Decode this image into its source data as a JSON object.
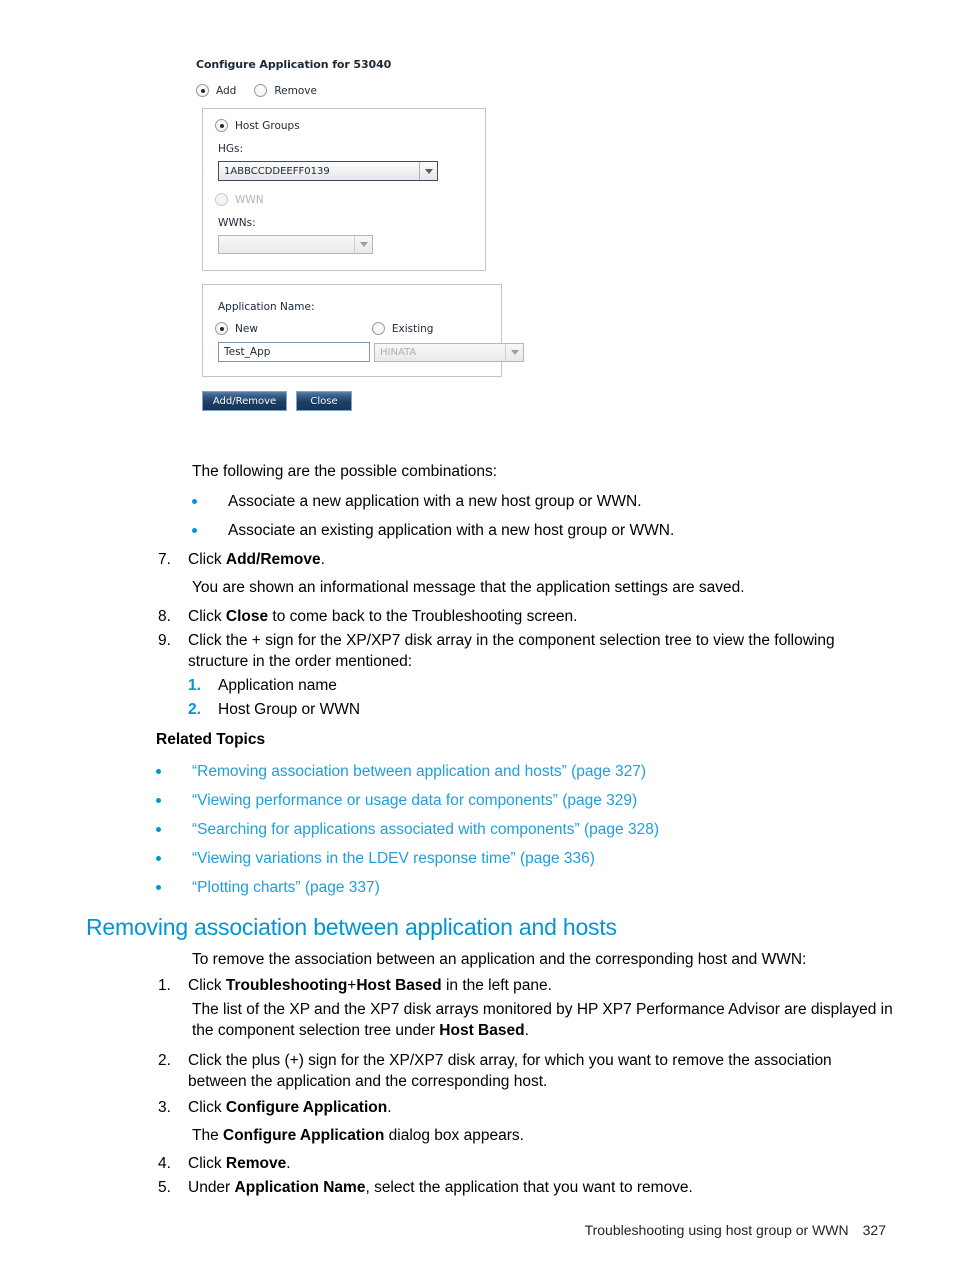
{
  "dialog": {
    "title": "Configure Application for 53040",
    "mode_radios": [
      {
        "label": "Add",
        "selected": true
      },
      {
        "label": "Remove",
        "selected": false
      }
    ],
    "host_panel": {
      "host_groups_radio": "Host Groups",
      "hgs_label": "HGs:",
      "hgs_value": "1ABBCCDDEEFF0139",
      "wwn_radio": "WWN",
      "wwns_label": "WWNs:",
      "wwns_value": ""
    },
    "app_panel": {
      "title": "Application Name:",
      "new_radio": "New",
      "existing_radio": "Existing",
      "new_value": "Test_App",
      "existing_value": "HINATA"
    },
    "buttons": {
      "add_remove": "Add/Remove",
      "close": "Close"
    }
  },
  "body": {
    "combinations_intro": "The following are the possible combinations:",
    "combination_bullets": [
      "Associate a new application with a new host group or WWN.",
      "Associate an existing application with a new host group or WWN."
    ],
    "step7_num": "7.",
    "step7_pre": "Click ",
    "step7_bold": "Add/Remove",
    "step7_post": ".",
    "step7_note": "You are shown an informational message that the application settings are saved.",
    "step8_num": "8.",
    "step8_pre": "Click ",
    "step8_bold": "Close",
    "step8_post": " to come back to the Troubleshooting screen.",
    "step9_num": "9.",
    "step9_text": "Click the + sign for the XP/XP7 disk array in the component selection tree to view the following structure in the order mentioned:",
    "sub_items": [
      {
        "num": "1.",
        "text": "Application name"
      },
      {
        "num": "2.",
        "text": "Host Group or WWN"
      }
    ],
    "related_topics_heading": "Related Topics",
    "related_topics": [
      "“Removing association between application and hosts” (page 327)",
      "“Viewing performance or usage data for components” (page 329)",
      "“Searching for applications associated with components” (page 328)",
      "“Viewing variations in the LDEV response time” (page 336)",
      "“Plotting charts” (page 337)"
    ]
  },
  "section": {
    "heading": "Removing association between application and hosts",
    "intro": "To remove the association between an application and the corresponding host and WWN:",
    "s1_num": "1.",
    "s1_pre": "Click ",
    "s1_bold1": "Troubleshooting",
    "s1_mid": "+",
    "s1_bold2": "Host Based",
    "s1_post": " in the left pane.",
    "s1_note_pre": "The list of the XP and the XP7 disk arrays monitored by HP XP7 Performance Advisor are displayed in the component selection tree under ",
    "s1_note_bold": "Host Based",
    "s1_note_post": ".",
    "s2_num": "2.",
    "s2_text": "Click the plus (+) sign for the XP/XP7 disk array, for which you want to remove the association between the application and the corresponding host.",
    "s3_num": "3.",
    "s3_pre": "Click ",
    "s3_bold": "Configure Application",
    "s3_post": ".",
    "s3_note_pre": "The ",
    "s3_note_bold": "Configure Application",
    "s3_note_post": " dialog box appears.",
    "s4_num": "4.",
    "s4_pre": "Click ",
    "s4_bold": "Remove",
    "s4_post": ".",
    "s5_num": "5.",
    "s5_pre": "Under ",
    "s5_bold": "Application Name",
    "s5_post": ", select the application that you want to remove."
  },
  "footer": {
    "text": "Troubleshooting using host group or WWN",
    "page": "327"
  },
  "colors": {
    "accent_blue": "#0096d6",
    "link_blue": "#1f9ed9"
  }
}
